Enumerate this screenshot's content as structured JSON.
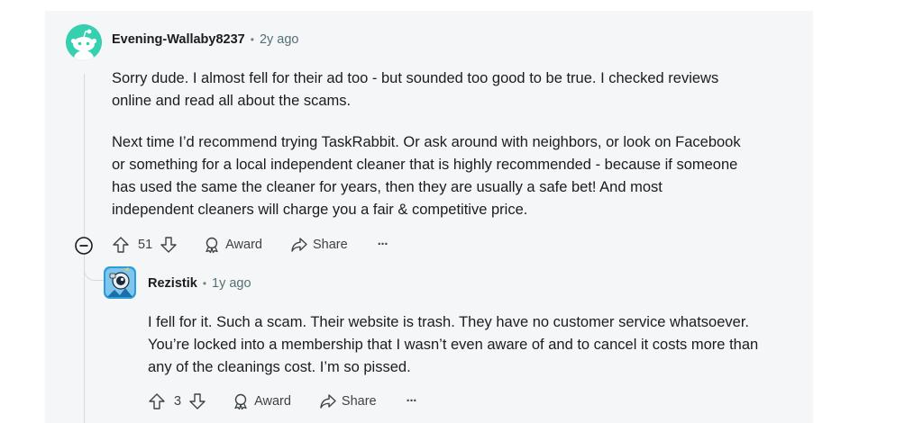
{
  "comment": {
    "author": "Evening-Wallaby8237",
    "separator": "•",
    "age": "2y ago",
    "paragraphs": [
      "Sorry dude. I almost fell for their ad too - but sounded too good to be true. I checked reviews online and read all about the scams.",
      "Next time I’d recommend trying TaskRabbit. Or ask around with neighbors, or look on Facebook or something for a local independent cleaner that is highly recommended - because if someone has used the same the cleaner for years, then they are usually a safe bet! And most independent cleaners will charge you a fair & competitive price."
    ],
    "votes": "51",
    "award_label": "Award",
    "share_label": "Share",
    "more_label": "···"
  },
  "reply": {
    "author": "Rezistik",
    "separator": "•",
    "age": "1y ago",
    "text": "I fell for it. Such a scam. Their website is trash. They have no customer service whatsoever. You’re locked into a membership that I wasn’t even aware of and to cancel it costs more than any of the cleanings cost. I’m so pissed.",
    "votes": "3",
    "award_label": "Award",
    "share_label": "Share",
    "more_label": "···"
  },
  "icons": {
    "upvote": "upvote-icon",
    "downvote": "downvote-icon",
    "award": "award-icon",
    "share": "share-icon",
    "collapse": "collapse-minus-icon"
  },
  "colors": {
    "panel_bg": "#f4f6f7",
    "avatar1_bg": "#34d0b0",
    "avatar2_bg": "#2d9cdb",
    "text": "#1c1c1c",
    "meta": "#576f76"
  }
}
